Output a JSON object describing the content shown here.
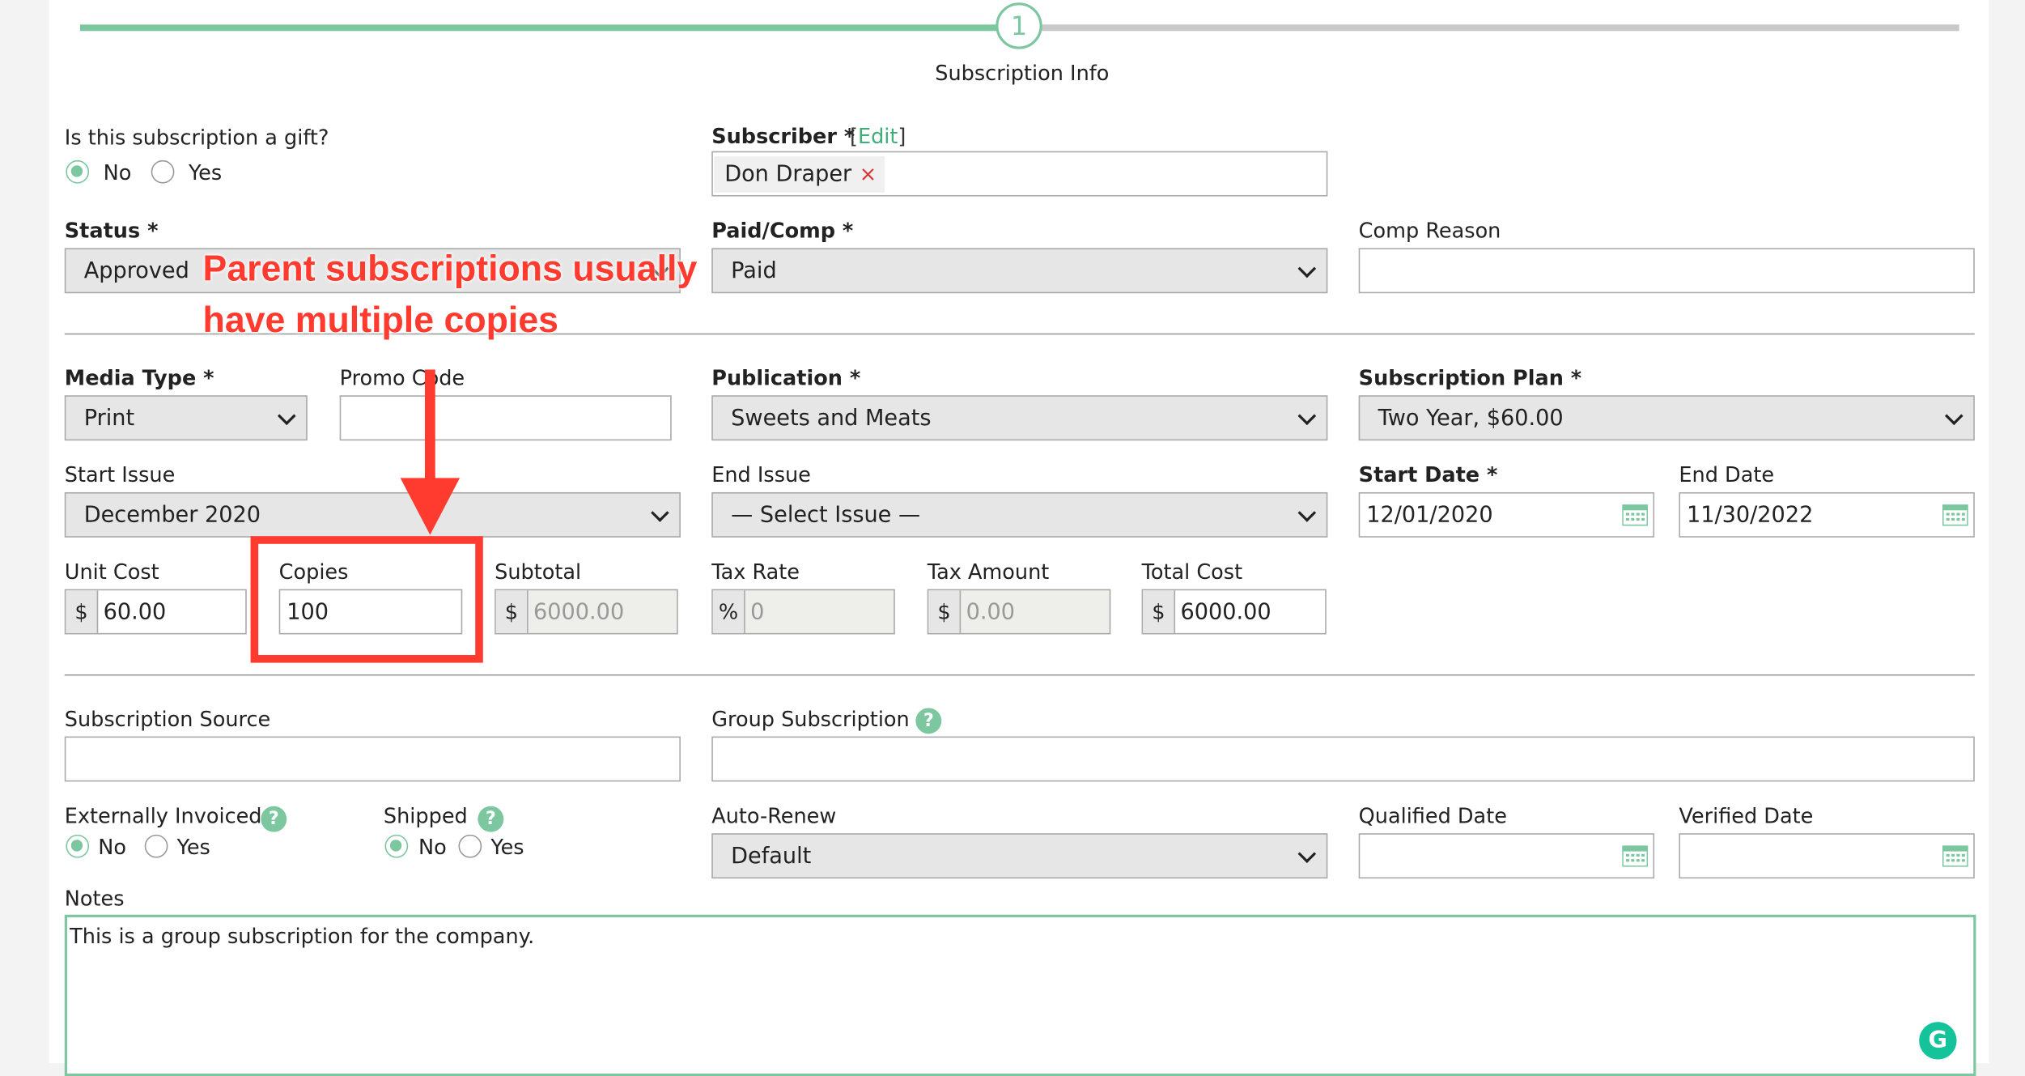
{
  "progress": {
    "step_number": "1",
    "step_label": "Subscription Info"
  },
  "gift": {
    "label": "Is this subscription a gift?",
    "options": [
      "No",
      "Yes"
    ],
    "selected": "No"
  },
  "subscriber": {
    "label": "Subscriber *",
    "edit_link": "Edit",
    "value": "Don Draper",
    "remove": "×"
  },
  "status": {
    "label": "Status *",
    "value": "Approved"
  },
  "paid_comp": {
    "label": "Paid/Comp *",
    "value": "Paid"
  },
  "comp_reason": {
    "label": "Comp Reason",
    "value": ""
  },
  "media_type": {
    "label": "Media Type *",
    "value": "Print"
  },
  "promo_code": {
    "label": "Promo Code",
    "value": ""
  },
  "publication": {
    "label": "Publication *",
    "value": "Sweets and Meats"
  },
  "subscription_plan": {
    "label": "Subscription Plan *",
    "value": "Two Year, $60.00"
  },
  "start_issue": {
    "label": "Start Issue",
    "value": "December 2020"
  },
  "end_issue": {
    "label": "End Issue",
    "value": "— Select Issue —"
  },
  "start_date": {
    "label": "Start Date *",
    "value": "12/01/2020"
  },
  "end_date": {
    "label": "End Date",
    "value": "11/30/2022"
  },
  "unit_cost": {
    "label": "Unit Cost",
    "prefix": "$",
    "value": "60.00"
  },
  "copies": {
    "label": "Copies",
    "value": "100"
  },
  "subtotal": {
    "label": "Subtotal",
    "prefix": "$",
    "value": "6000.00"
  },
  "tax_rate": {
    "label": "Tax Rate",
    "prefix": "%",
    "value": "0"
  },
  "tax_amount": {
    "label": "Tax Amount",
    "prefix": "$",
    "value": "0.00"
  },
  "total_cost": {
    "label": "Total Cost",
    "prefix": "$",
    "value": "6000.00"
  },
  "subscription_source": {
    "label": "Subscription Source",
    "value": ""
  },
  "group_subscription": {
    "label": "Group Subscription",
    "help": "?",
    "value": ""
  },
  "externally_invoiced": {
    "label": "Externally Invoiced",
    "help": "?",
    "options": [
      "No",
      "Yes"
    ],
    "selected": "No"
  },
  "shipped": {
    "label": "Shipped",
    "help": "?",
    "options": [
      "No",
      "Yes"
    ],
    "selected": "No"
  },
  "auto_renew": {
    "label": "Auto-Renew",
    "value": "Default"
  },
  "qualified_date": {
    "label": "Qualified Date",
    "value": ""
  },
  "verified_date": {
    "label": "Verified Date",
    "value": ""
  },
  "notes": {
    "label": "Notes",
    "value": "This is a group subscription for the company."
  },
  "annotation": {
    "line1": "Parent subscriptions usually",
    "line2": "have multiple copies"
  },
  "colors": {
    "accent": "#7cc7a0",
    "annotation": "#ff3b2f",
    "grammarly": "#15c39a"
  },
  "icons": [
    "calendar-icon",
    "help-icon",
    "remove-icon",
    "chevron-down-icon",
    "grammarly-icon",
    "arrow-icon"
  ]
}
